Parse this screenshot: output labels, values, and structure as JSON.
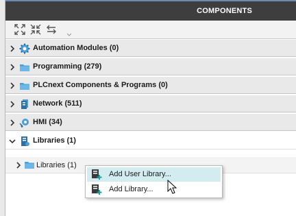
{
  "panel": {
    "title": "COMPONENTS"
  },
  "toolbar": {
    "buttons": [
      {
        "icon": "expand-all-icon"
      },
      {
        "icon": "collapse-all-icon"
      },
      {
        "icon": "swap-arrows-icon"
      }
    ]
  },
  "categories": [
    {
      "label": "Automation Modules (0)",
      "icon": "gear-modules-icon",
      "expanded": false
    },
    {
      "label": "Programming (279)",
      "icon": "folder-icon",
      "expanded": false
    },
    {
      "label": "PLCnext Components & Programs (0)",
      "icon": "folder-icon",
      "expanded": false
    },
    {
      "label": "Network (511)",
      "icon": "network-device-icon",
      "expanded": false
    },
    {
      "label": "HMI (34)",
      "icon": "hmi-gear-icon",
      "expanded": false
    },
    {
      "label": "Libraries (1)",
      "icon": "library-icon",
      "expanded": true
    }
  ],
  "libraries_subitem": {
    "label": "Libraries (1)",
    "icon": "folder-icon"
  },
  "context_menu": {
    "items": [
      {
        "label": "Add User Library...",
        "icon": "add-user-library-icon",
        "highlighted": true
      },
      {
        "label": "Add Library...",
        "icon": "add-library-icon",
        "highlighted": false
      }
    ]
  },
  "colors": {
    "header_bg": "#3e3e3e",
    "header_accent": "#6b8db5",
    "folder_blue": "#4a9fd8",
    "add_teal": "#1aa3a3",
    "menu_highlight": "#d3ecef"
  }
}
